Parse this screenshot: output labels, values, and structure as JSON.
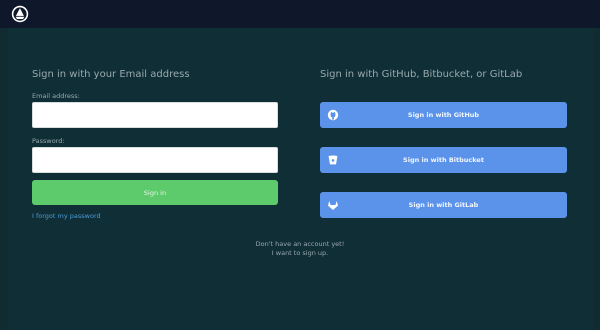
{
  "email_section": {
    "heading": "Sign in with your Email address",
    "email_label": "Email address:",
    "email_value": "",
    "email_placeholder": "",
    "password_label": "Password:",
    "password_value": "",
    "password_placeholder": "",
    "signin_label": "Sign in",
    "forgot_link": "I forgot my password"
  },
  "oauth_section": {
    "heading": "Sign in with GitHub, Bitbucket, or GitLab",
    "buttons": [
      {
        "label": "Sign in with GitHub",
        "icon": "github-icon"
      },
      {
        "label": "Sign in with Bitbucket",
        "icon": "bitbucket-icon"
      },
      {
        "label": "Sign in with GitLab",
        "icon": "gitlab-icon"
      }
    ]
  },
  "signup": {
    "line1": "Don't have an account yet!",
    "line2": "I want to sign up."
  },
  "colors": {
    "background": "#0f2e36",
    "topbar": "#0f172a",
    "signin_button": "#5dca6b",
    "oauth_button": "#5b93ea",
    "link": "#4e9bd6"
  }
}
